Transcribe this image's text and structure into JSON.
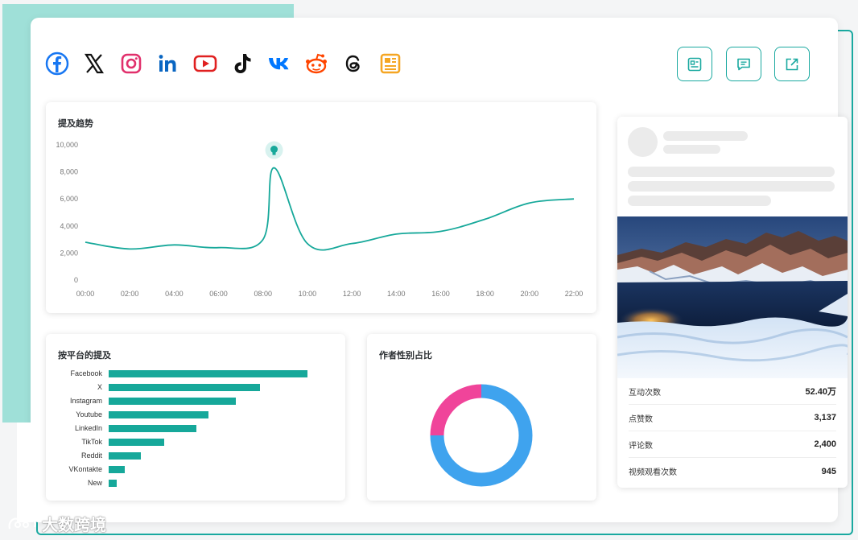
{
  "social_icons": [
    {
      "name": "facebook-icon",
      "color": "#1877f2"
    },
    {
      "name": "x-icon",
      "color": "#111111"
    },
    {
      "name": "instagram-icon",
      "color": "#e1306c"
    },
    {
      "name": "linkedin-icon",
      "color": "#0a66c2"
    },
    {
      "name": "youtube-icon",
      "color": "#e02020"
    },
    {
      "name": "tiktok-icon",
      "color": "#111111"
    },
    {
      "name": "vk-icon",
      "color": "#0077ff"
    },
    {
      "name": "reddit-icon",
      "color": "#ff4500"
    },
    {
      "name": "threads-icon",
      "color": "#111111"
    },
    {
      "name": "news-icon",
      "color": "#f5a623"
    }
  ],
  "toolbar": [
    {
      "name": "article-icon"
    },
    {
      "name": "comment-icon"
    },
    {
      "name": "external-link-icon"
    }
  ],
  "trend": {
    "title": "提及趋势"
  },
  "platforms": {
    "title": "按平台的提及"
  },
  "gender": {
    "title": "作者性别占比"
  },
  "post": {
    "stats": [
      {
        "label": "互动次数",
        "value": "52.40万"
      },
      {
        "label": "点赞数",
        "value": "3,137"
      },
      {
        "label": "评论数",
        "value": "2,400"
      },
      {
        "label": "视频观看次数",
        "value": "945"
      }
    ]
  },
  "watermark": "大数跨境",
  "colors": {
    "accent": "#16a89a",
    "pink": "#f0449a",
    "blue": "#3fa3ee"
  },
  "chart_data": [
    {
      "type": "line",
      "title": "提及趋势",
      "x": [
        "00:00",
        "02:00",
        "04:00",
        "06:00",
        "08:00",
        "10:00",
        "12:00",
        "14:00",
        "16:00",
        "18:00",
        "20:00",
        "22:00"
      ],
      "x_ticks": [
        "00:00",
        "02:00",
        "04:00",
        "06:00",
        "08:00",
        "10:00",
        "12:00",
        "14:00",
        "16:00",
        "18:00",
        "20:00",
        "22:00"
      ],
      "series": [
        {
          "values": [
            2800,
            2300,
            2600,
            2400,
            3000,
            2700,
            2700,
            3400,
            3600,
            4500,
            5700,
            6000
          ]
        }
      ],
      "peak": {
        "x": 8.5,
        "y": 8300
      },
      "ylim": [
        0,
        10000
      ],
      "y_ticks": [
        "0",
        "2,000",
        "4,000",
        "6,000",
        "8,000",
        "10,000"
      ],
      "grid": false
    },
    {
      "type": "bar",
      "title": "按平台的提及",
      "orientation": "horizontal",
      "categories": [
        "Facebook",
        "X",
        "Instagram",
        "Youtube",
        "LinkedIn",
        "TikTok",
        "Reddit",
        "VKontakte",
        "New"
      ],
      "values": [
        100,
        76,
        64,
        50,
        44,
        28,
        16,
        8,
        4
      ]
    },
    {
      "type": "pie",
      "title": "作者性别占比",
      "donut": true,
      "slices": [
        {
          "value": 75,
          "color": "#3fa3ee"
        },
        {
          "value": 25,
          "color": "#f0449a"
        }
      ]
    }
  ]
}
